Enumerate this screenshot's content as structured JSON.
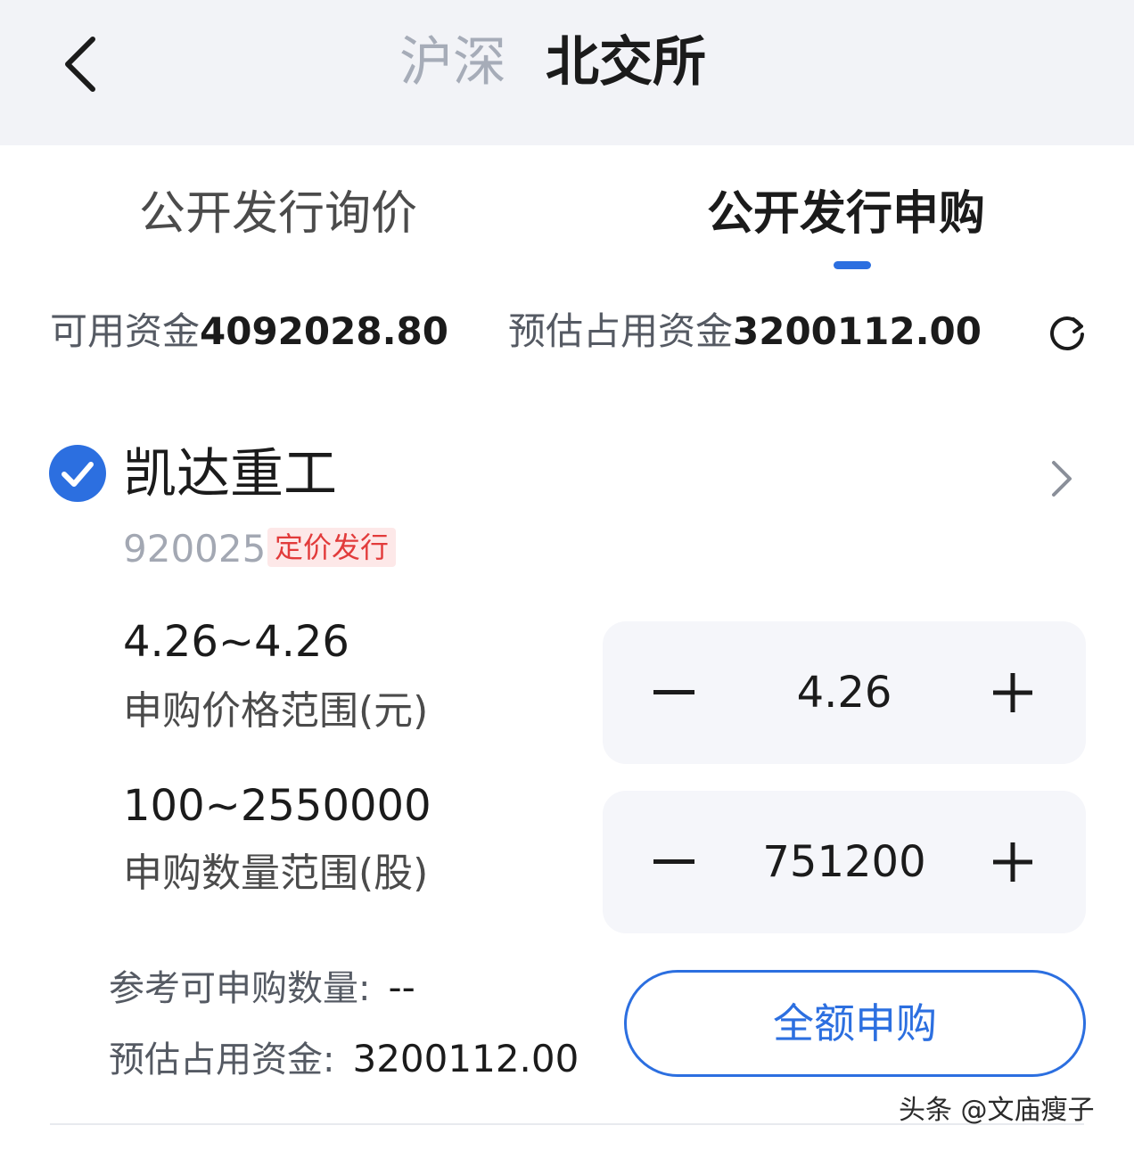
{
  "header": {
    "market_tabs": [
      "沪深",
      "北交所"
    ],
    "active_market": "北交所"
  },
  "sub_tabs": {
    "left": "公开发行询价",
    "right": "公开发行申购",
    "active": "公开发行申购"
  },
  "funds": {
    "available_label": "可用资金",
    "available_value": "4092028.80",
    "estimated_label": "预估占用资金",
    "estimated_value": "3200112.00"
  },
  "stock": {
    "name": "凯达重工",
    "code": "920025",
    "badge": "定价发行",
    "selected": true,
    "price_range": "4.26~4.26",
    "price_range_label": "申购价格范围(元)",
    "qty_range": "100~2550000",
    "qty_range_label": "申购数量范围(股)",
    "price_input": "4.26",
    "qty_input": "751200",
    "ref_qty_label": "参考可申购数量:",
    "ref_qty_value": "--",
    "est_funds_label": "预估占用资金:",
    "est_funds_value": "3200112.00",
    "full_button": "全额申购"
  },
  "watermark": "头条 @文庙瘦子",
  "colors": {
    "accent": "#2c6fe0",
    "badge_text": "#e23b3b",
    "badge_bg": "#fde8e8",
    "header_bg": "#f2f3f7"
  },
  "icons": [
    "back-icon",
    "refresh-icon",
    "check-circle-icon",
    "chevron-right-icon",
    "minus-icon",
    "plus-icon"
  ]
}
